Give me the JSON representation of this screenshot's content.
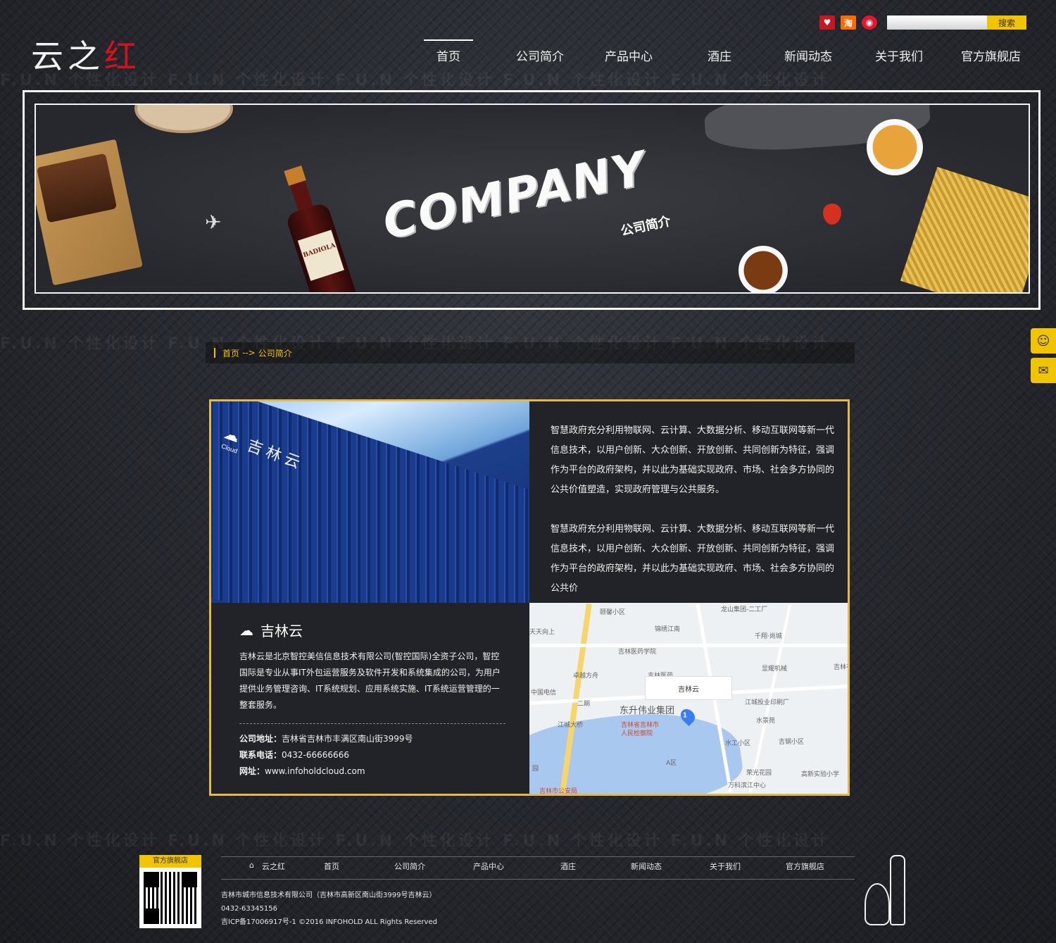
{
  "brand": {
    "logo_main": "云之",
    "logo_red": "红"
  },
  "topbar": {
    "social": [
      {
        "name": "kaixin",
        "glyph": "♥"
      },
      {
        "name": "taobao",
        "glyph": "淘"
      },
      {
        "name": "weibo",
        "glyph": "◉"
      }
    ],
    "search_button": "搜索"
  },
  "nav": {
    "items": [
      "首页",
      "公司简介",
      "产品中心",
      "酒庄",
      "新闻动态",
      "关于我们",
      "官方旗舰店"
    ],
    "active": "首页"
  },
  "banner": {
    "title": "COMPANY",
    "subtitle": "公司简介",
    "bottle_label": "BADIOLA"
  },
  "breadcrumb": {
    "home": "首页",
    "sep": "-->",
    "current": "公司简介"
  },
  "about": {
    "paragraphs": [
      "智慧政府充分利用物联网、云计算、大数据分析、移动互联网等新一代信息技术，以用户创新、大众创新、开放创新、共同创新为特征，强调作为平台的政府架构，并以此为基础实现政府、市场、社会多方协同的公共价值塑造，实现政府管理与公共服务。",
      "智慧政府充分利用物联网、云计算、大数据分析、移动互联网等新一代信息技术，以用户创新、大众创新、开放创新、共同创新为特征，强调作为平台的政府架构，并以此为基础实现政府、市场、社会多方协同的公共价"
    ],
    "building_sign": "吉林云",
    "building_logo_text": "Cloud"
  },
  "company": {
    "name": "吉林云",
    "description": "吉林云是北京智控美信信息技术有限公司(智控国际)全资子公司，智控国际是专业从事IT外包运营服务及软件开发和系统集成的公司，为用户提供业务管理咨询、IT系统规划、应用系统实施、IT系统运营管理的一整套服务。",
    "address_label": "公司地址：",
    "address": "吉林省吉林市丰满区南山街3999号",
    "phone_label": "联系电话：",
    "phone": "0432-66666666",
    "site_label": "网址：",
    "site": "www.infoholdcloud.com"
  },
  "map": {
    "pin_label": "吉林云",
    "pin_number": "1",
    "big_label": "东升伟业集团",
    "labels": [
      "颐馨小区",
      "龙山集团-二工厂",
      "锦绣江南",
      "天天向上",
      "吉林医药学院",
      "千翔·尚城",
      "卓越方舟",
      "吉林医药",
      "显耀机械",
      "吉林有限",
      "中国电信",
      "二期",
      "江城投业印刷厂",
      "江城大桥",
      "水景苑",
      "吉林省吉林市",
      "人民检察院",
      "水工小区",
      "吉钢小区",
      "A区",
      "荣光花园",
      "万科滨江中心",
      "高新实验小学",
      "吉林市公安局",
      "园"
    ]
  },
  "footer": {
    "qr_title": "官方旗舰店",
    "nav": [
      "云之红",
      "首页",
      "公司简介",
      "产品中心",
      "酒庄",
      "新闻动态",
      "关于我们",
      "官方旗舰店"
    ],
    "company_line": "吉林市城市信息技术有限公司（吉林市高新区南山街3999号吉林云）",
    "phone": "0432-63345156",
    "icp": "吉ICP备17006917号-1 ©2016 INFOHOLD ALL Rights Reserved"
  },
  "side_tools": [
    {
      "name": "service-icon",
      "glyph": "☺"
    },
    {
      "name": "chat-icon",
      "glyph": "✉"
    }
  ],
  "colors": {
    "accent": "#f1c400",
    "brand_red": "#d4121b",
    "box_border": "#e6b84c"
  }
}
